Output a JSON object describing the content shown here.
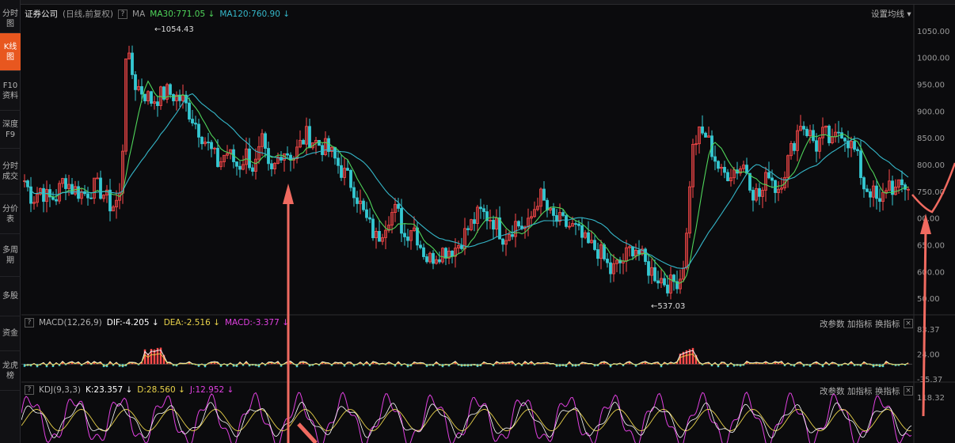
{
  "sidebar": {
    "items": [
      {
        "label": "分时图"
      },
      {
        "label": "K线图",
        "active": true
      },
      {
        "label": "F10资料"
      },
      {
        "label": "深度F9"
      },
      {
        "label": "分时成交"
      },
      {
        "label": "分价表"
      },
      {
        "label": "多周期"
      },
      {
        "label": "多股"
      },
      {
        "label": "资金"
      },
      {
        "label": "龙虎榜"
      }
    ]
  },
  "main_panel": {
    "title": "证券公司",
    "subtitle": "(日线,前复权)",
    "help": "?",
    "ma_label": "MA",
    "ma30": "MA30:771.05",
    "ma120": "MA120:760.90",
    "settings_label": "设置均线",
    "high_annotation": "1054.43",
    "low_annotation": "537.03",
    "y_ticks": [
      "1050.00",
      "1000.00",
      "950.00",
      "900.00",
      "850.00",
      "800.00",
      "750.00",
      "700.00",
      "650.00",
      "600.00",
      "550.00"
    ],
    "y_tick_labels": [
      "1050.00",
      "1000.00",
      "950.00",
      "900.00",
      "850.00",
      "800.00",
      "750.00",
      "00.00",
      "650.00",
      "600.00",
      "50.00"
    ]
  },
  "macd_panel": {
    "help": "?",
    "name": "MACD(12,26,9)",
    "dif": "DIF:-4.205",
    "dea": "DEA:-2.516",
    "macd": "MACD:-3.377",
    "btn_params": "改参数",
    "btn_add": "加指标",
    "btn_switch": "换指标",
    "close": "×",
    "y_ticks": [
      "83.37",
      "24.00",
      "-35.37"
    ]
  },
  "kdj_panel": {
    "help": "?",
    "name": "KDJ(9,3,3)",
    "k": "K:23.357",
    "d": "D:28.560",
    "j": "J:12.952",
    "btn_params": "改参数",
    "btn_add": "加指标",
    "btn_switch": "换指标",
    "close": "×",
    "y_ticks": [
      "118.32"
    ]
  },
  "colors": {
    "up": "#ff4a4a",
    "down": "#35c8d2",
    "ma30": "#4fd45a",
    "ma120": "#35b7c9",
    "dif": "#ffffff",
    "dea": "#e8d24a",
    "macd": "#e040e0",
    "k": "#ffffff",
    "d": "#e8d24a",
    "j": "#e040e0",
    "arrow": "#f06a60",
    "active_tab": "#e8571f"
  },
  "chart_data": [
    {
      "type": "candlestick",
      "title": "证券公司",
      "y_range": [
        525,
        1075
      ],
      "high": 1054.43,
      "low": 537.03,
      "series": [
        {
          "name": "MA30",
          "value": 771.05
        },
        {
          "name": "MA120",
          "value": 760.9
        }
      ],
      "close_anchors": [
        [
          0,
          770
        ],
        [
          10,
          735
        ],
        [
          20,
          755
        ],
        [
          30,
          735
        ],
        [
          40,
          740
        ],
        [
          50,
          775
        ],
        [
          60,
          755
        ],
        [
          75,
          745
        ],
        [
          90,
          760
        ],
        [
          100,
          745
        ],
        [
          110,
          720
        ],
        [
          118,
          735
        ],
        [
          122,
          745
        ],
        [
          128,
          1010
        ],
        [
          140,
          950
        ],
        [
          160,
          920
        ],
        [
          180,
          935
        ],
        [
          200,
          920
        ],
        [
          215,
          880
        ],
        [
          230,
          840
        ],
        [
          245,
          800
        ],
        [
          255,
          825
        ],
        [
          270,
          795
        ],
        [
          280,
          820
        ],
        [
          290,
          790
        ],
        [
          300,
          840
        ],
        [
          310,
          775
        ],
        [
          325,
          830
        ],
        [
          340,
          815
        ],
        [
          355,
          855
        ],
        [
          370,
          840
        ],
        [
          385,
          825
        ],
        [
          400,
          790
        ],
        [
          415,
          760
        ],
        [
          430,
          700
        ],
        [
          445,
          660
        ],
        [
          460,
          705
        ],
        [
          470,
          715
        ],
        [
          480,
          665
        ],
        [
          490,
          690
        ],
        [
          500,
          650
        ],
        [
          510,
          620
        ],
        [
          520,
          635
        ],
        [
          530,
          640
        ],
        [
          545,
          645
        ],
        [
          560,
          680
        ],
        [
          575,
          710
        ],
        [
          590,
          700
        ],
        [
          605,
          665
        ],
        [
          620,
          690
        ],
        [
          635,
          680
        ],
        [
          650,
          745
        ],
        [
          665,
          700
        ],
        [
          680,
          690
        ],
        [
          695,
          680
        ],
        [
          710,
          650
        ],
        [
          725,
          640
        ],
        [
          740,
          600
        ],
        [
          755,
          620
        ],
        [
          770,
          650
        ],
        [
          785,
          610
        ],
        [
          800,
          590
        ],
        [
          815,
          575
        ],
        [
          828,
          590
        ],
        [
          835,
          640
        ],
        [
          842,
          820
        ],
        [
          850,
          855
        ],
        [
          860,
          855
        ],
        [
          870,
          820
        ],
        [
          880,
          780
        ],
        [
          895,
          790
        ],
        [
          910,
          800
        ],
        [
          920,
          750
        ],
        [
          930,
          740
        ],
        [
          940,
          790
        ],
        [
          950,
          750
        ],
        [
          960,
          790
        ],
        [
          970,
          835
        ],
        [
          980,
          880
        ],
        [
          990,
          860
        ],
        [
          1000,
          835
        ],
        [
          1010,
          860
        ],
        [
          1020,
          835
        ],
        [
          1030,
          870
        ],
        [
          1040,
          845
        ],
        [
          1050,
          820
        ],
        [
          1060,
          760
        ],
        [
          1070,
          750
        ],
        [
          1080,
          720
        ],
        [
          1090,
          770
        ],
        [
          1100,
          750
        ],
        [
          1110,
          760
        ]
      ]
    },
    {
      "type": "macd",
      "name": "MACD(12,26,9)",
      "y_range": [
        -35.37,
        83.37
      ],
      "y_ticks": [
        83.37,
        24.0,
        -35.37
      ],
      "series": [
        {
          "name": "DIF",
          "value": -4.205
        },
        {
          "name": "DEA",
          "value": -2.516
        },
        {
          "name": "MACD",
          "value": -3.377
        }
      ]
    },
    {
      "type": "kdj",
      "name": "KDJ(9,3,3)",
      "y_ticks": [
        118.32
      ],
      "series": [
        {
          "name": "K",
          "value": 23.357
        },
        {
          "name": "D",
          "value": 28.56
        },
        {
          "name": "J",
          "value": 12.952
        }
      ]
    }
  ]
}
